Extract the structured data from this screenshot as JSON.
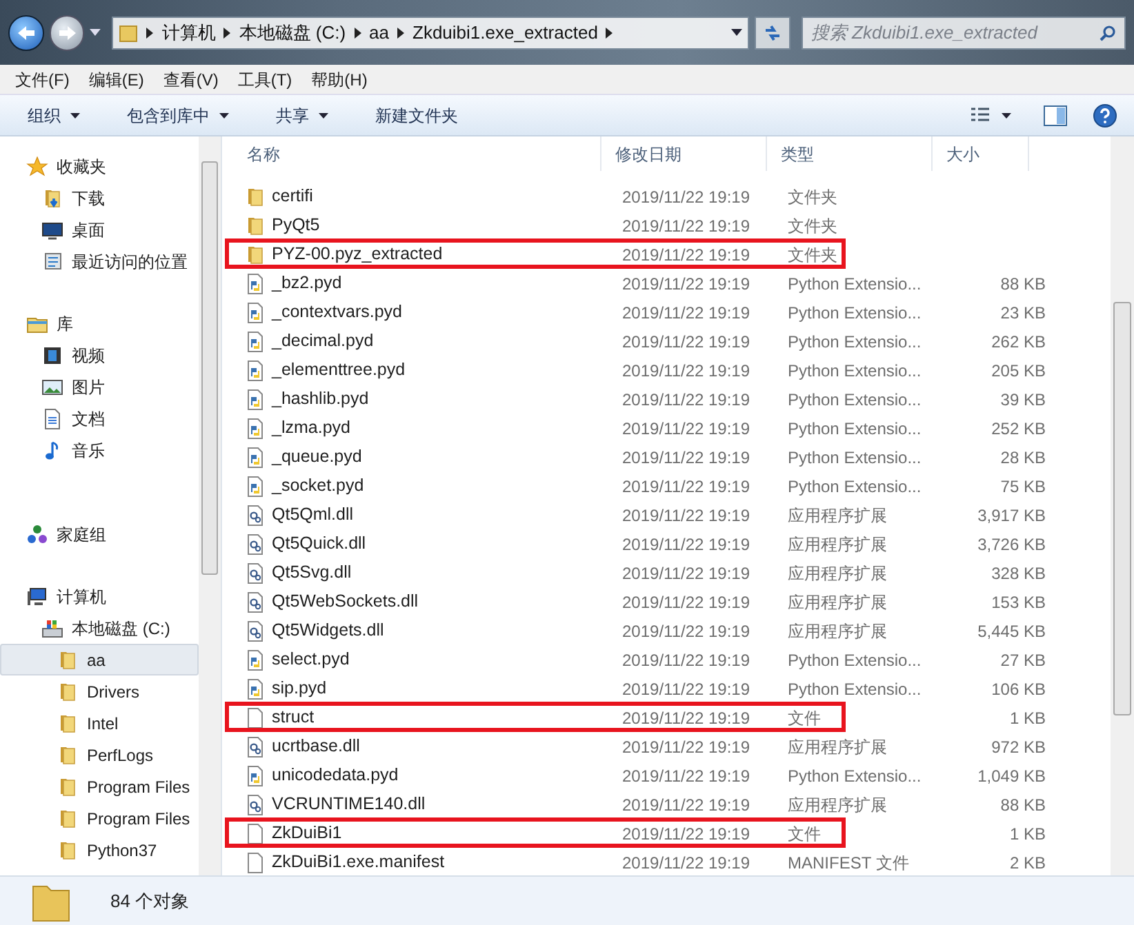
{
  "address_bar": {
    "crumbs": [
      "计算机",
      "本地磁盘 (C:)",
      "aa",
      "Zkduibi1.exe_extracted"
    ]
  },
  "search": {
    "placeholder": "搜索 Zkduibi1.exe_extracted"
  },
  "menu": [
    "文件(F)",
    "编辑(E)",
    "查看(V)",
    "工具(T)",
    "帮助(H)"
  ],
  "toolbar": [
    {
      "label": "组织",
      "dropdown": true
    },
    {
      "label": "包含到库中",
      "dropdown": true
    },
    {
      "label": "共享",
      "dropdown": true
    },
    {
      "label": "新建文件夹",
      "dropdown": false
    }
  ],
  "sidebar": {
    "groups": [
      {
        "label": "收藏夹",
        "kind": "star",
        "children": [
          {
            "label": "下载",
            "kind": "download"
          },
          {
            "label": "桌面",
            "kind": "desktop"
          },
          {
            "label": "最近访问的位置",
            "kind": "recent"
          }
        ]
      },
      {
        "label": "库",
        "kind": "library",
        "children": [
          {
            "label": "视频",
            "kind": "video"
          },
          {
            "label": "图片",
            "kind": "image"
          },
          {
            "label": "文档",
            "kind": "doc"
          },
          {
            "label": "音乐",
            "kind": "music"
          }
        ]
      },
      {
        "label": "家庭组",
        "kind": "homegroup"
      },
      {
        "label": "计算机",
        "kind": "computer",
        "children": [
          {
            "label": "本地磁盘 (C:)",
            "kind": "drive",
            "selected": false,
            "children": [
              {
                "label": "aa",
                "kind": "folder",
                "selected": true
              },
              {
                "label": "Drivers",
                "kind": "folder",
                "selected": false
              },
              {
                "label": "Intel",
                "kind": "folder",
                "selected": false
              },
              {
                "label": "PerfLogs",
                "kind": "folder",
                "selected": false
              },
              {
                "label": "Program Files",
                "kind": "folder",
                "selected": false
              },
              {
                "label": "Program Files",
                "kind": "folder",
                "selected": false
              },
              {
                "label": "Python37",
                "kind": "folder",
                "selected": false
              }
            ]
          }
        ]
      }
    ]
  },
  "table": {
    "columns": [
      "名称",
      "修改日期",
      "类型",
      "大小"
    ],
    "rows": [
      {
        "kind": "folder",
        "name": "certifi",
        "date": "2019/11/22 19:19",
        "type": "文件夹",
        "highlighted": false
      },
      {
        "kind": "folder",
        "name": "PyQt5",
        "date": "2019/11/22 19:19",
        "type": "文件夹",
        "highlighted": false
      },
      {
        "kind": "folder",
        "name": "PYZ-00.pyz_extracted",
        "date": "2019/11/22 19:19",
        "type": "文件夹",
        "highlighted": true
      },
      {
        "kind": "pyd",
        "name": "_bz2.pyd",
        "date": "2019/11/22 19:19",
        "type": "Python Extensio...",
        "size": "88 KB",
        "highlighted": false
      },
      {
        "kind": "pyd",
        "name": "_contextvars.pyd",
        "date": "2019/11/22 19:19",
        "type": "Python Extensio...",
        "size": "23 KB",
        "highlighted": false
      },
      {
        "kind": "pyd",
        "name": "_decimal.pyd",
        "date": "2019/11/22 19:19",
        "type": "Python Extensio...",
        "size": "262 KB",
        "highlighted": false
      },
      {
        "kind": "pyd",
        "name": "_elementtree.pyd",
        "date": "2019/11/22 19:19",
        "type": "Python Extensio...",
        "size": "205 KB",
        "highlighted": false
      },
      {
        "kind": "pyd",
        "name": "_hashlib.pyd",
        "date": "2019/11/22 19:19",
        "type": "Python Extensio...",
        "size": "39 KB",
        "highlighted": false
      },
      {
        "kind": "pyd",
        "name": "_lzma.pyd",
        "date": "2019/11/22 19:19",
        "type": "Python Extensio...",
        "size": "252 KB",
        "highlighted": false
      },
      {
        "kind": "pyd",
        "name": "_queue.pyd",
        "date": "2019/11/22 19:19",
        "type": "Python Extensio...",
        "size": "28 KB",
        "highlighted": false
      },
      {
        "kind": "pyd",
        "name": "_socket.pyd",
        "date": "2019/11/22 19:19",
        "type": "Python Extensio...",
        "size": "75 KB",
        "highlighted": false
      },
      {
        "kind": "dll",
        "name": "Qt5Qml.dll",
        "date": "2019/11/22 19:19",
        "type": "应用程序扩展",
        "size": "3,917 KB",
        "highlighted": false
      },
      {
        "kind": "dll",
        "name": "Qt5Quick.dll",
        "date": "2019/11/22 19:19",
        "type": "应用程序扩展",
        "size": "3,726 KB",
        "highlighted": false
      },
      {
        "kind": "dll",
        "name": "Qt5Svg.dll",
        "date": "2019/11/22 19:19",
        "type": "应用程序扩展",
        "size": "328 KB",
        "highlighted": false
      },
      {
        "kind": "dll",
        "name": "Qt5WebSockets.dll",
        "date": "2019/11/22 19:19",
        "type": "应用程序扩展",
        "size": "153 KB",
        "highlighted": false
      },
      {
        "kind": "dll",
        "name": "Qt5Widgets.dll",
        "date": "2019/11/22 19:19",
        "type": "应用程序扩展",
        "size": "5,445 KB",
        "highlighted": false
      },
      {
        "kind": "pyd",
        "name": "select.pyd",
        "date": "2019/11/22 19:19",
        "type": "Python Extensio...",
        "size": "27 KB",
        "highlighted": false
      },
      {
        "kind": "pyd",
        "name": "sip.pyd",
        "date": "2019/11/22 19:19",
        "type": "Python Extensio...",
        "size": "106 KB",
        "highlighted": false
      },
      {
        "kind": "file",
        "name": "struct",
        "date": "2019/11/22 19:19",
        "type": "文件",
        "size": "1 KB",
        "highlighted": true
      },
      {
        "kind": "dll",
        "name": "ucrtbase.dll",
        "date": "2019/11/22 19:19",
        "type": "应用程序扩展",
        "size": "972 KB",
        "highlighted": false
      },
      {
        "kind": "pyd",
        "name": "unicodedata.pyd",
        "date": "2019/11/22 19:19",
        "type": "Python Extensio...",
        "size": "1,049 KB",
        "highlighted": false
      },
      {
        "kind": "dll",
        "name": "VCRUNTIME140.dll",
        "date": "2019/11/22 19:19",
        "type": "应用程序扩展",
        "size": "88 KB",
        "highlighted": false
      },
      {
        "kind": "file",
        "name": "ZkDuiBi1",
        "date": "2019/11/22 19:19",
        "type": "文件",
        "size": "1 KB",
        "highlighted": true
      },
      {
        "kind": "file",
        "name": "ZkDuiBi1.exe.manifest",
        "date": "2019/11/22 19:19",
        "type": "MANIFEST 文件",
        "size": "2 KB",
        "highlighted": false
      }
    ]
  },
  "status_bar": {
    "count": "84 个对象"
  }
}
